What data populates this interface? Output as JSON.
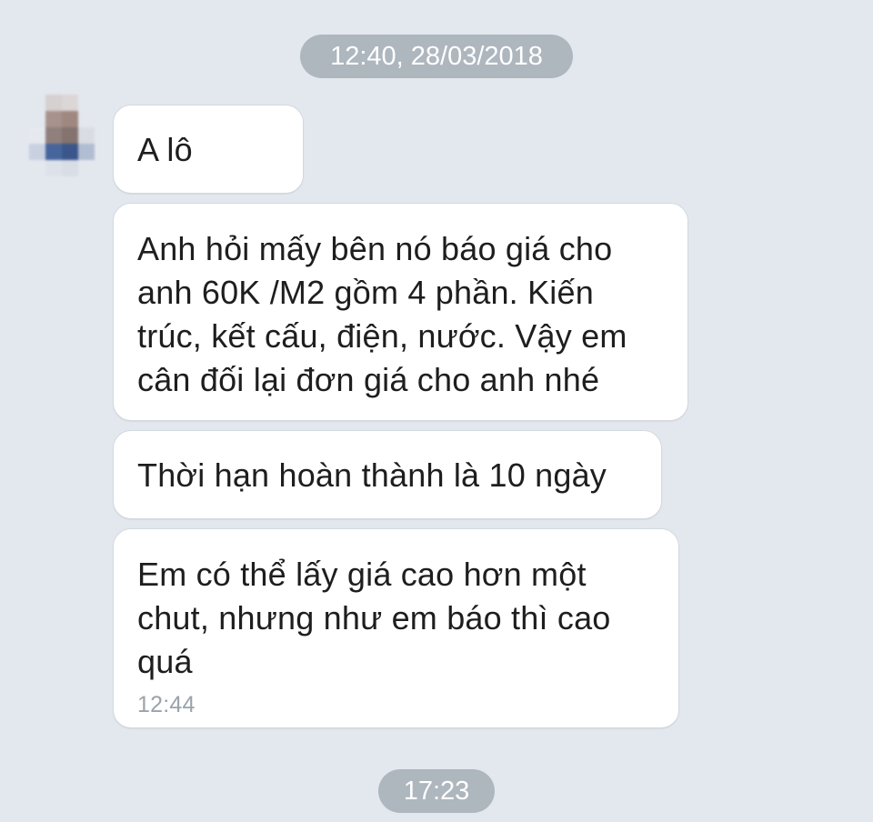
{
  "timestamps": {
    "top": "12:40, 28/03/2018",
    "bottom": "17:23"
  },
  "sender": {
    "avatar": "blurred-profile-picture"
  },
  "messages": [
    {
      "lines": [
        "A lô"
      ]
    },
    {
      "lines": [
        "Anh hỏi mấy bên nó báo giá cho",
        "anh 60K /M2 gồm 4 phần. Kiến",
        "trúc, kết cấu, điện, nước. Vậy em",
        "cân đối lại đơn giá cho anh nhé"
      ]
    },
    {
      "lines": [
        "Thời hạn hoàn thành là 10 ngày"
      ]
    },
    {
      "lines": [
        "Em có thể lấy giá cao hơn một",
        "chut, nhưng như em báo thì cao",
        "quá"
      ],
      "time": "12:44"
    }
  ],
  "colors": {
    "background": "#e3e8ee",
    "bubble": "#ffffff",
    "pill": "#aeb6be",
    "text": "#1e1e1e",
    "meta_text": "#9aa3ab"
  }
}
